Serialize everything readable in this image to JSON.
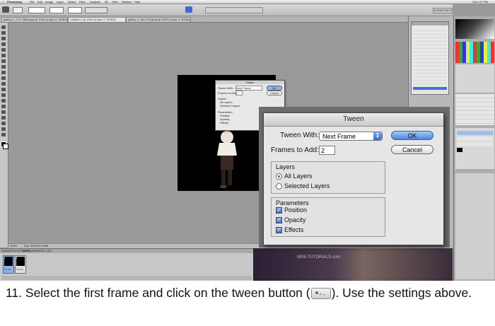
{
  "mac_menubar": {
    "items": [
      "Photoshop",
      "File",
      "Edit",
      "Image",
      "Layer",
      "Select",
      "Filter",
      "Analysis",
      "3D",
      "View",
      "Window",
      "Help"
    ],
    "clock": "Sat 4:17 PM"
  },
  "workspace": {
    "essentials_label": "ESSENTIALS"
  },
  "document": {
    "title": "Untitled-1 @ 100% (Layer 2, RGB/8)"
  },
  "doc_tabs": [
    {
      "label": "gallery-1_172-7988 jpeg @ 100% (Layer 0, RGB/8)"
    },
    {
      "label": "Untitled-1 @ 100% (Layer 2, RGB/8)"
    },
    {
      "label": "gallery-1_36-1713.jpeg @ 100% (Layer 0, RGB/8)"
    }
  ],
  "status": {
    "zoom": "100%",
    "doc_size": "Doc: 878.9K/1.09M"
  },
  "small_tween": {
    "title": "Tween",
    "tween_with_label": "Tween With:",
    "tween_with_value": "Next Frame",
    "frames_label": "Frames to Add:",
    "frames_value": "2",
    "layers_title": "Layers",
    "all_layers": "All Layers",
    "selected_layers": "Selected Layers",
    "params_title": "Parameters",
    "position": "Position",
    "opacity": "Opacity",
    "effects": "Effects",
    "ok": "OK",
    "cancel": "Cancel"
  },
  "tween_dialog": {
    "title": "Tween",
    "tween_with_label": "Tween With:",
    "tween_with_value": "Next Frame",
    "frames_label": "Frames to Add:",
    "frames_value": "2",
    "layers_title": "Layers",
    "all_layers": "All Layers",
    "selected_layers": "Selected Layers",
    "params_title": "Parameters",
    "position": "Position",
    "opacity": "Opacity",
    "effects": "Effects",
    "ok": "OK",
    "cancel": "Cancel",
    "selected_radio": "all_layers",
    "checked": [
      "position",
      "opacity",
      "effects"
    ]
  },
  "animation_panel": {
    "tabs": [
      "ANIMATION (FRAMES)",
      "MEASUREMENT LOG"
    ],
    "frames": [
      {
        "number": "1",
        "delay": "0.2 sec.",
        "selected": true
      },
      {
        "number": "2",
        "delay": "0.2 sec.",
        "selected": false
      }
    ]
  },
  "watermark": "MINI-TUTORIALS.com",
  "caption": {
    "text_before": "11. Select the first frame and click on the tween button (",
    "text_after": "). Use the settings above."
  },
  "colors": {
    "accent": "#3b72cf",
    "dialog_bg": "#e6e6e6",
    "canvas_bg": "#999999"
  }
}
